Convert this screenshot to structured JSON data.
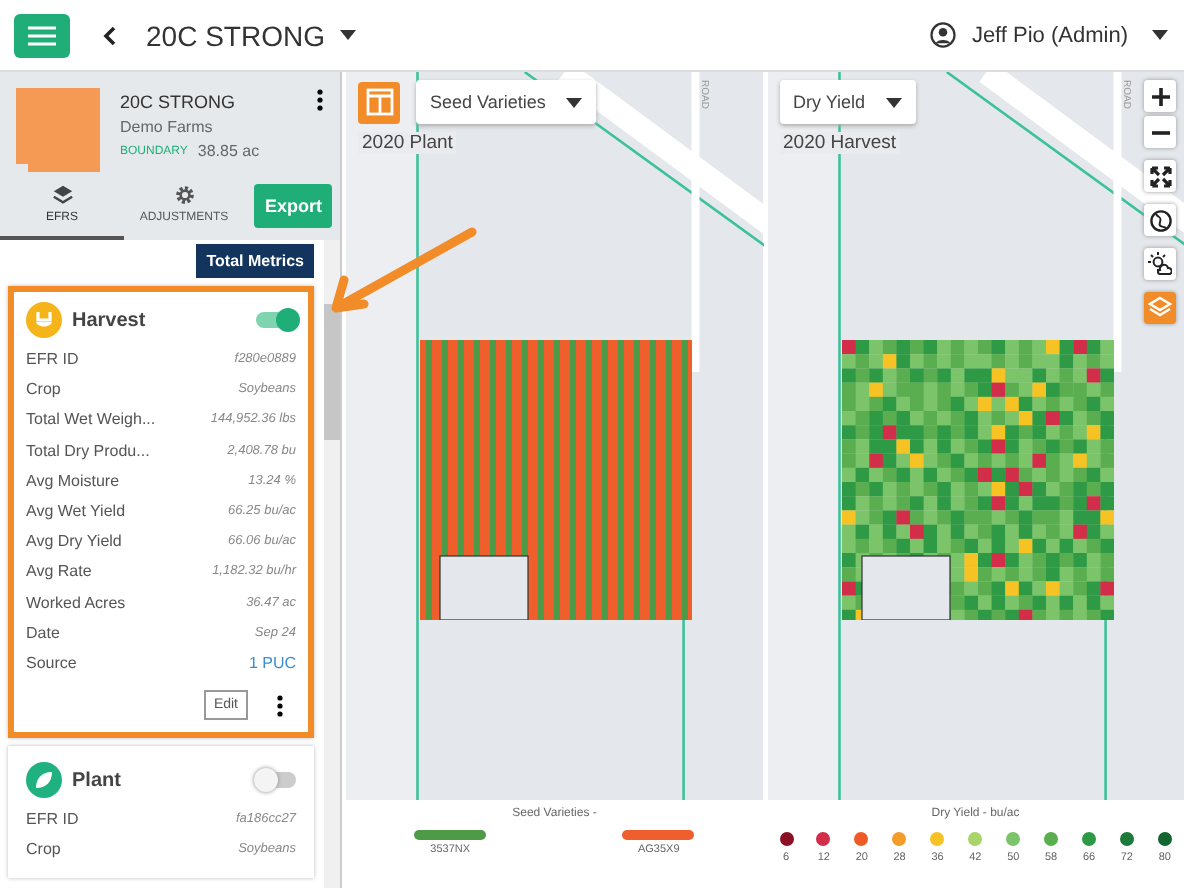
{
  "topbar": {
    "title": "20C STRONG",
    "user": "Jeff Pio (Admin)"
  },
  "field": {
    "name": "20C STRONG",
    "farm": "Demo Farms",
    "tag": "BOUNDARY",
    "area": "38.85 ac"
  },
  "tabs": [
    {
      "label": "EFRS",
      "selected": true
    },
    {
      "label": "ADJUSTMENTS",
      "selected": false
    }
  ],
  "export_button": "Export",
  "total_metrics_button": "Total Metrics",
  "cards": [
    {
      "kind": "harvest",
      "title": "Harvest",
      "on": true,
      "highlighted": true,
      "edit_button": "Edit",
      "rows": [
        {
          "label": "EFR ID",
          "value": "f280e0889",
          "kind": "text"
        },
        {
          "label": "Crop",
          "value": "Soybeans",
          "kind": "text"
        },
        {
          "label": "Total Wet Weigh...",
          "value": "144,952.36 lbs",
          "kind": "text"
        },
        {
          "label": "Total Dry Produ...",
          "value": "2,408.78 bu",
          "kind": "text"
        },
        {
          "label": "Avg Moisture",
          "value": "13.24 %",
          "kind": "text"
        },
        {
          "label": "Avg Wet Yield",
          "value": "66.25 bu/ac",
          "kind": "text"
        },
        {
          "label": "Avg Dry Yield",
          "value": "66.06 bu/ac",
          "kind": "text"
        },
        {
          "label": "Avg Rate",
          "value": "1,182.32 bu/hr",
          "kind": "text"
        },
        {
          "label": "Worked Acres",
          "value": "36.47 ac",
          "kind": "text"
        },
        {
          "label": "Date",
          "value": "Sep 24",
          "kind": "text"
        },
        {
          "label": "Source",
          "value": "1 PUC",
          "kind": "link"
        }
      ]
    },
    {
      "kind": "plant",
      "title": "Plant",
      "on": false,
      "highlighted": false,
      "rows": [
        {
          "label": "EFR ID",
          "value": "fa186cc27",
          "kind": "text"
        },
        {
          "label": "Crop",
          "value": "Soybeans",
          "kind": "text"
        }
      ]
    }
  ],
  "maps": [
    {
      "kind": "varieties",
      "layer": "Seed Varieties",
      "title": "2020 Plant",
      "road_label": "ROAD",
      "legend": {
        "title": "Seed Varieties -",
        "items": [
          {
            "label": "3537NX",
            "color": "#4e9a47"
          },
          {
            "label": "AG35X9",
            "color": "#ef5f2c"
          }
        ]
      }
    },
    {
      "kind": "yield",
      "layer": "Dry Yield",
      "title": "2020 Harvest",
      "road_label": "ROAD",
      "legend": {
        "title": "Dry Yield - bu/ac",
        "items": [
          {
            "label": "6",
            "color": "#8b1024"
          },
          {
            "label": "12",
            "color": "#d22e49"
          },
          {
            "label": "20",
            "color": "#ee5a24"
          },
          {
            "label": "28",
            "color": "#f39c2a"
          },
          {
            "label": "36",
            "color": "#f6c224"
          },
          {
            "label": "42",
            "color": "#a9d46a"
          },
          {
            "label": "50",
            "color": "#7cc46a"
          },
          {
            "label": "58",
            "color": "#5aae50"
          },
          {
            "label": "66",
            "color": "#2e9a45"
          },
          {
            "label": "72",
            "color": "#1d7a3a"
          },
          {
            "label": "80",
            "color": "#11652f"
          }
        ]
      }
    }
  ]
}
